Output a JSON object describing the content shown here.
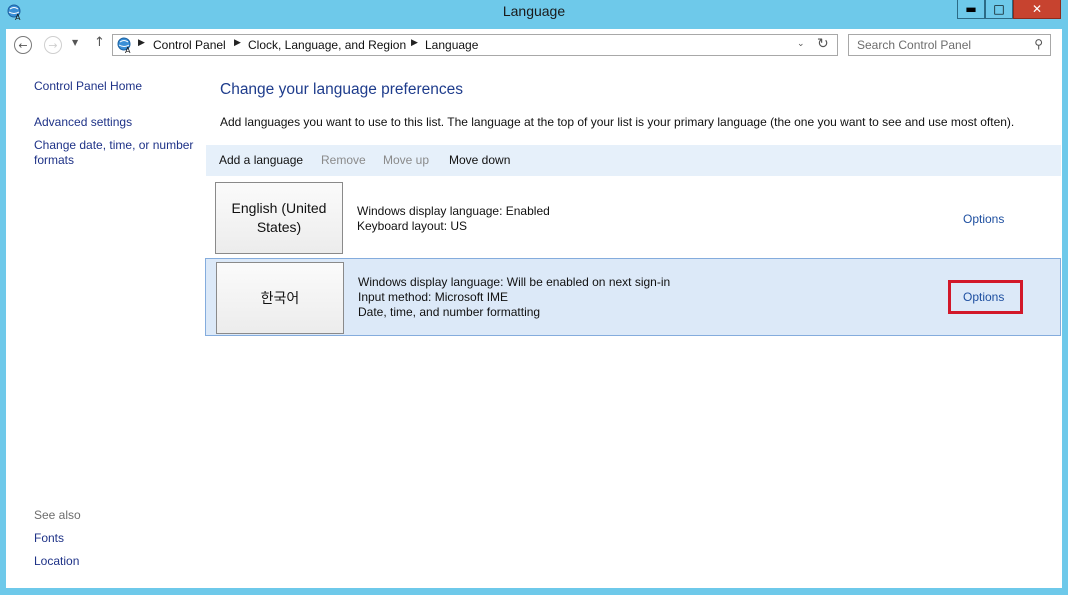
{
  "window": {
    "title": "Language"
  },
  "address_bar": {
    "crumbs": [
      "Control Panel",
      "Clock, Language, and Region",
      "Language"
    ]
  },
  "search": {
    "placeholder": "Search Control Panel"
  },
  "sidebar": {
    "home": "Control Panel Home",
    "advanced": "Advanced settings",
    "change_date": "Change date, time, or number formats",
    "see_also": "See also",
    "fonts": "Fonts",
    "location": "Location"
  },
  "main": {
    "heading": "Change your language preferences",
    "description": "Add languages you want to use to this list. The language at the top of your list is your primary language (the one you want to see and use most often)."
  },
  "toolbar": {
    "add": "Add a language",
    "remove": "Remove",
    "move_up": "Move up",
    "move_down": "Move down"
  },
  "languages": [
    {
      "name": "English (United States)",
      "lines": [
        "Windows display language: Enabled",
        "Keyboard layout: US"
      ],
      "options": "Options",
      "selected": false
    },
    {
      "name": "한국어",
      "lines": [
        "Windows display language: Will be enabled on next sign-in",
        "Input method: Microsoft IME",
        "Date, time, and number formatting"
      ],
      "options": "Options",
      "selected": true
    }
  ],
  "colors": {
    "frame": "#6ec9ea",
    "link": "#1e3287",
    "highlight": "#d2182a",
    "selected_row": "#dce9f8"
  }
}
